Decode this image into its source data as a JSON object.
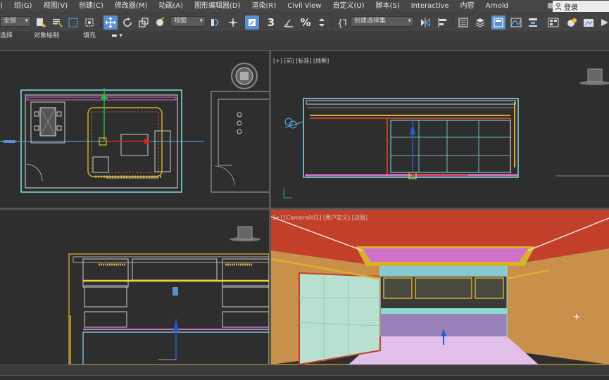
{
  "menu": {
    "items": [
      "组(G)",
      "视图(V)",
      "创建(C)",
      "修改器(M)",
      "动画(A)",
      "图形编辑器(D)",
      "渲染(R)",
      "Civil View",
      "自定义(U)",
      "脚本(S)",
      "Interactive",
      "内容",
      "Arnold"
    ],
    "leading_fragment": ")",
    "login_label": "登录",
    "login_icon": "user-icon"
  },
  "toolbar": {
    "selection_filter": "全部",
    "reference_coord": "视图",
    "named_selection": "创建选择集",
    "snap_value": "3",
    "icons": [
      "select-object-icon",
      "select-by-name-icon",
      "rect-selection-region-icon",
      "window-crossing-icon",
      "select-and-move-icon",
      "select-and-rotate-icon",
      "select-and-scale-icon",
      "select-and-place-icon",
      "select-manipulate-icon",
      "keyboard-shortcut-icon",
      "snap-toggle-icon",
      "angle-snap-icon",
      "percent-snap-icon",
      "spinner-snap-icon",
      "edit-named-selection-icon",
      "mirror-icon",
      "align-icon",
      "scene-explorer-icon",
      "layer-explorer-icon",
      "toggle-ribbon-icon",
      "curve-editor-icon",
      "schematic-view-icon",
      "material-editor-icon",
      "render-setup-icon",
      "render-frame-icon",
      "render-icon"
    ]
  },
  "ribbon": {
    "tabs": [
      "选择",
      "对象绘制",
      "填充"
    ]
  },
  "viewports": {
    "top_right_label": "[+] [前] [标准] [线框]",
    "bottom_right_label": "[+] [Camera001] [用户定义] [边面]"
  },
  "colors": {
    "active_accent": "#5a8fd0",
    "active_viewport_border": "#d6a000",
    "wall_yellow": "#d8b030",
    "outline_cyan": "#7fe0e8",
    "ceiling_red": "#c2402a",
    "ceiling_pink": "#d070c8",
    "wall_tan": "#c8904a",
    "glass_green": "#b8e0d0",
    "floor_lilac": "#e0c0e8"
  }
}
